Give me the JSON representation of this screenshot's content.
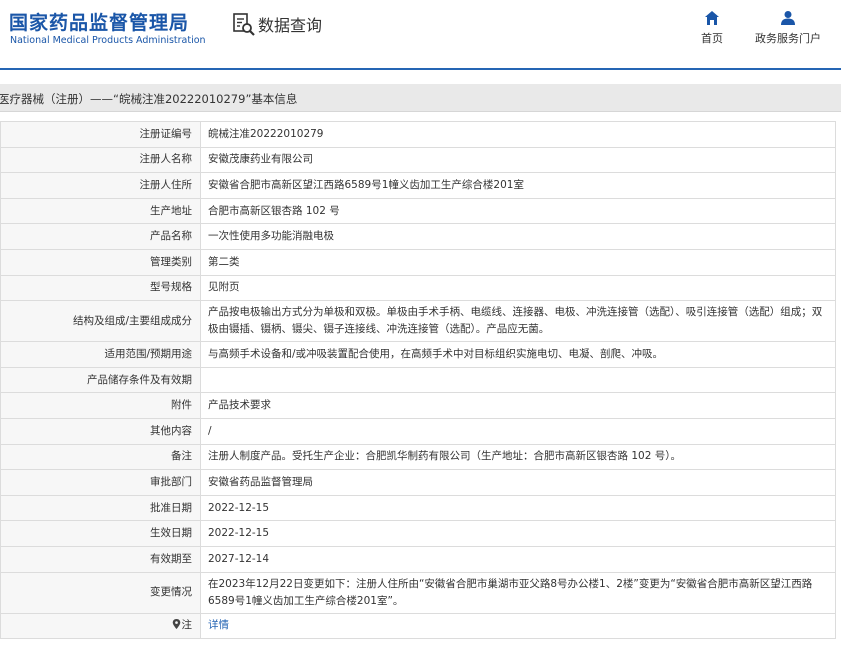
{
  "header": {
    "logo_cn": "国家药品监督管理局",
    "logo_en": "National Medical Products Administration",
    "query_title": "数据查询",
    "nav": [
      {
        "label": "首页",
        "icon": "home-icon"
      },
      {
        "label": "政务服务门户",
        "icon": "user-icon"
      }
    ],
    "brand_color": "#1a56a8"
  },
  "page_title": "医疗器械（注册）——“皖械注准20222010279”基本信息",
  "fields": [
    {
      "key": "注册证编号",
      "value": "皖械注准20222010279"
    },
    {
      "key": "注册人名称",
      "value": "安徽茂康药业有限公司"
    },
    {
      "key": "注册人住所",
      "value": "安徽省合肥市高新区望江西路6589号1幢义齿加工生产综合楼201室"
    },
    {
      "key": "生产地址",
      "value": "合肥市高新区银杏路 102 号"
    },
    {
      "key": "产品名称",
      "value": "一次性使用多功能消融电极"
    },
    {
      "key": "管理类别",
      "value": "第二类"
    },
    {
      "key": "型号规格",
      "value": "见附页"
    },
    {
      "key": "结构及组成/主要组成成分",
      "value": "产品按电极输出方式分为单极和双极。单极由手术手柄、电缆线、连接器、电极、冲洗连接管（选配）、吸引连接管（选配）组成；双极由镊插、镊柄、镊尖、镊子连接线、冲洗连接管（选配）。产品应无菌。"
    },
    {
      "key": "适用范围/预期用途",
      "value": "与高频手术设备和/或冲吸装置配合使用，在高频手术中对目标组织实施电切、电凝、剖爬、冲吸。"
    },
    {
      "key": "产品储存条件及有效期",
      "value": ""
    },
    {
      "key": "附件",
      "value": "产品技术要求"
    },
    {
      "key": "其他内容",
      "value": "/"
    },
    {
      "key": "备注",
      "value": "注册人制度产品。受托生产企业：合肥凯华制药有限公司（生产地址：合肥市高新区银杏路 102 号）。"
    },
    {
      "key": "审批部门",
      "value": "安徽省药品监督管理局"
    },
    {
      "key": "批准日期",
      "value": "2022-12-15"
    },
    {
      "key": "生效日期",
      "value": "2022-12-15"
    },
    {
      "key": "有效期至",
      "value": "2027-12-14"
    },
    {
      "key": "变更情况",
      "value": "在2023年12月22日变更如下：注册人住所由“安徽省合肥市巢湖市亚父路8号办公楼1、2楼”变更为“安徽省合肥市高新区望江西路6589号1幢义齿加工生产综合楼201室”。"
    }
  ],
  "note": {
    "key": "注",
    "value": "详情",
    "icon": "pin-icon"
  }
}
